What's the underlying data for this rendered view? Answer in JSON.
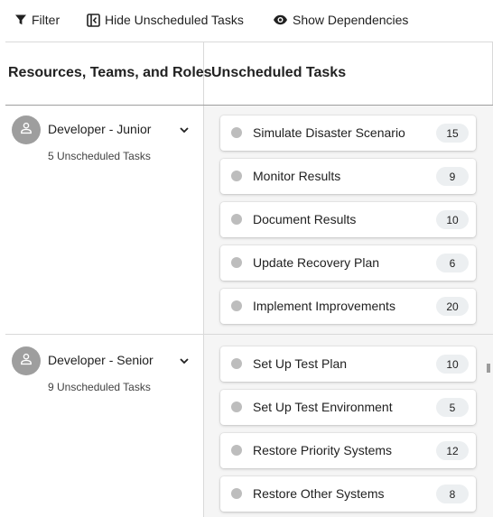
{
  "toolbar": {
    "filter_label": "Filter",
    "hide_unscheduled_label": "Hide Unscheduled Tasks",
    "show_dependencies_label": "Show Dependencies"
  },
  "columns": {
    "resources_header": "Resources, Teams, and Roles",
    "tasks_header": "Unscheduled Tasks"
  },
  "resources": [
    {
      "name": "Developer - Junior",
      "count_label": "5 Unscheduled Tasks",
      "tasks": [
        {
          "title": "Simulate Disaster Scenario",
          "badge": "15"
        },
        {
          "title": "Monitor Results",
          "badge": "9"
        },
        {
          "title": "Document Results",
          "badge": "10"
        },
        {
          "title": "Update Recovery Plan",
          "badge": "6"
        },
        {
          "title": "Implement Improvements",
          "badge": "20"
        }
      ]
    },
    {
      "name": "Developer - Senior",
      "count_label": "9 Unscheduled Tasks",
      "tasks": [
        {
          "title": "Set Up Test Plan",
          "badge": "10"
        },
        {
          "title": "Set Up Test Environment",
          "badge": "5"
        },
        {
          "title": "Restore Priority Systems",
          "badge": "12"
        },
        {
          "title": "Restore Other Systems",
          "badge": "8"
        }
      ]
    }
  ],
  "icons": {
    "filter": "filter-icon",
    "hide_unscheduled": "collapse-left-panel-icon",
    "show_dependencies": "eye-icon",
    "avatar": "person-icon",
    "expand": "chevron-down-icon",
    "task_status": "status-dot-icon"
  },
  "colors": {
    "avatar_bg": "#9e9e9e",
    "task_area_bg": "#f5f5f5",
    "badge_bg": "#eceff1",
    "dot": "#bdbdbd"
  }
}
